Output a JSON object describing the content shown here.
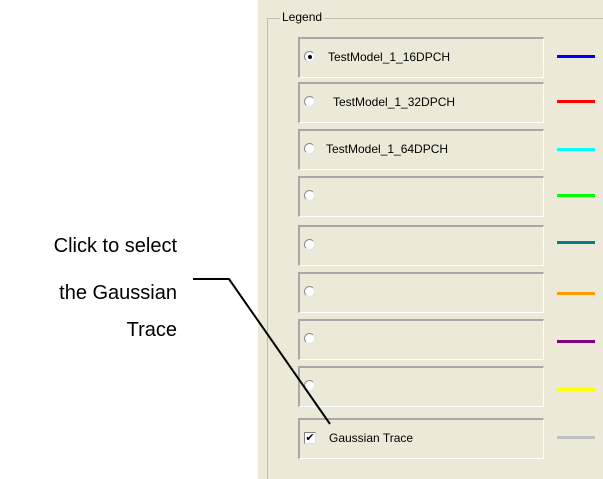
{
  "legend": {
    "title": "Legend",
    "items": [
      {
        "label": "TestModel_1_16DPCH",
        "control": "radio",
        "selected": true,
        "color": "#0000ff"
      },
      {
        "label": "TestModel_1_32DPCH",
        "control": "radio",
        "selected": false,
        "color": "#ff0000"
      },
      {
        "label": "TestModel_1_64DPCH",
        "control": "radio",
        "selected": false,
        "color": "#00ffff"
      },
      {
        "label": "",
        "control": "radio",
        "selected": false,
        "color": "#00ff00"
      },
      {
        "label": "",
        "control": "radio",
        "selected": false,
        "color": "#008080"
      },
      {
        "label": "",
        "control": "radio",
        "selected": false,
        "color": "#ff9900"
      },
      {
        "label": "",
        "control": "radio",
        "selected": false,
        "color": "#800080"
      },
      {
        "label": "",
        "control": "radio",
        "selected": false,
        "color": "#ffff00"
      },
      {
        "label": "Gaussian Trace",
        "control": "checkbox",
        "checked": true,
        "color": "#c0c0c0"
      }
    ]
  },
  "callout": {
    "lines": [
      "Click to select",
      "the Gaussian",
      "Trace"
    ]
  }
}
